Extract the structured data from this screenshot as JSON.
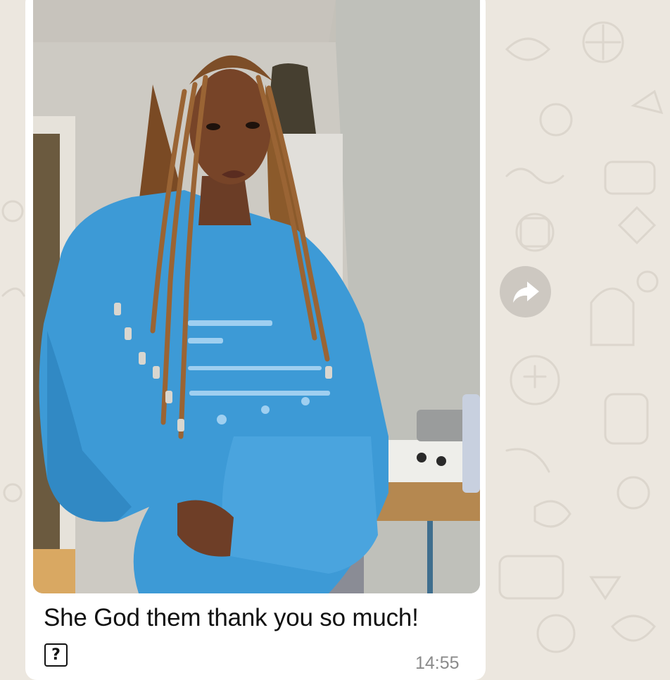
{
  "message": {
    "image_description_name": "photo-attachment",
    "caption": "She God them thank you so much!",
    "unsupported_glyph": "?",
    "timestamp": "14:55"
  },
  "actions": {
    "forward_icon": "forward-arrow-icon"
  },
  "colors": {
    "chat_wallpaper": "#ece7df",
    "bubble": "#ffffff",
    "caption_text": "#111111",
    "timestamp_text": "#8a8a8a",
    "forward_button": "#cdc8c1",
    "hoodie": "#3d9ad6"
  }
}
